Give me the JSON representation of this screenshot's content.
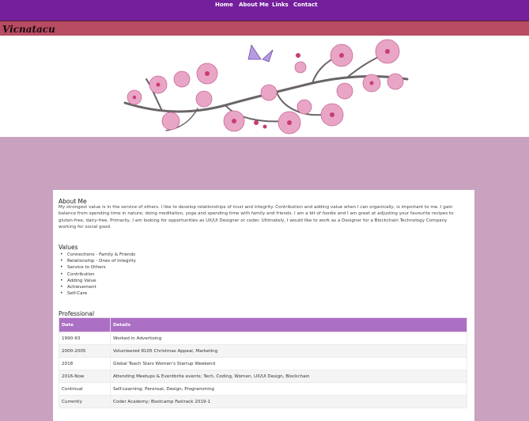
{
  "nav": [
    "Home",
    "About Me",
    "Links",
    "Contact"
  ],
  "brand": "Vicnatacu",
  "about": {
    "heading": "About Me",
    "text": "My strongest value is in the service of others. I like to develop relationships of trust and integrity. Contribution and adding value when I can organically, is important to me. I gain balance from spending time in nature; doing meditation, yoga and spending time with family and friends. I am a bit of foodie and I am great at adjusting your favourite recipes to gluten-free, dairy-free. Primarily, I am looking for opportunities as UX/UI Designer or coder. Ultimately, I would like to work as a Designer for a Blockchain Technology Company working for social good."
  },
  "values": {
    "heading": "Values",
    "items": [
      "Connections - Family & Friends",
      "Relationship - Ones of Integrity",
      "Service to Others",
      "Contribution",
      "Adding Value",
      "Achievement",
      "Self-Care"
    ]
  },
  "professional": {
    "heading": "Professional",
    "columns": [
      "Date",
      "Details"
    ],
    "rows": [
      [
        "1990-93",
        "Worked in Advertising"
      ],
      [
        "2000-2005",
        "Volunteered 8105 Christmas Appeal, Marketing"
      ],
      [
        "2018",
        "Global Teach Stars Women's Startup Weekend"
      ],
      [
        "2016-Now",
        "Attending Meetups & Eventbrite events; Tech, Coding, Women, UX/UI Design, Blockchain"
      ],
      [
        "Continual",
        "Self-Learning; Peronsal, Design, Programming"
      ],
      [
        "Currently",
        "Coder Academy; Bootcamp Fastrack 2019-1"
      ]
    ]
  },
  "colors": {
    "nav": "#74209c",
    "brandbar": "#b74c62",
    "page": "#c9a2bf",
    "tableHeader": "#ab6fc4"
  }
}
